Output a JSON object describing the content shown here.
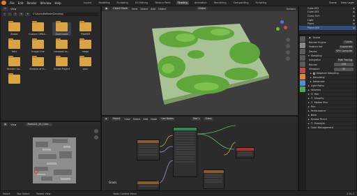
{
  "menubar": {
    "items": [
      "File",
      "Edit",
      "Render",
      "Window",
      "Help"
    ],
    "workspaces": [
      "Layout",
      "Modeling",
      "Sculpting",
      "UV Editing",
      "Texture Paint",
      "Shading",
      "Animation",
      "Rendering",
      "Compositing",
      "Scripting"
    ],
    "active_workspace": "Shading",
    "scene": "Scene",
    "view_layer": "View Layer"
  },
  "filebrowser": {
    "header": [
      "View"
    ],
    "path": "C:\\Users\\Raffaele\\Desktop\\",
    "folders": [
      "Adobe",
      "Custom Office...",
      "Downloads",
      "FRAMER",
      "Hdrs",
      "Image-Line",
      "Lossepel Le...",
      "mega",
      "Reclaim Ga...",
      "Shadow of th...",
      "Unreal Project",
      "vpsn",
      ""
    ]
  },
  "viewport": {
    "menu": [
      "Object Mode",
      "View",
      "Select",
      "Add",
      "Object"
    ],
    "global": "Global",
    "options": "Options"
  },
  "outliner": {
    "items": [
      "Cube.003",
      "Cube.003",
      "Grass Turf",
      "Light",
      "Plane",
      "Plane.000"
    ]
  },
  "properties": {
    "scene": "Scene",
    "render_engine": {
      "label": "Render Engine",
      "value": "Cycles"
    },
    "feature_set": {
      "label": "Feature Set",
      "value": "Supported"
    },
    "device": {
      "label": "Device",
      "value": "GPU Compute"
    },
    "sampling": "Sampling",
    "integrator": "Integrator",
    "integrator_value": "Path Tracing",
    "render_label": "Render",
    "render_value": "128",
    "viewport_label": "Viewport",
    "viewport_value": "32",
    "subsections": [
      "Adaptive Sampling",
      "Denoising",
      "Advanced"
    ],
    "panels": [
      "Light Paths",
      "Volumes",
      "Hair",
      "Simplify",
      "Motion Blur",
      "Film",
      "Performance",
      "Bake",
      "Grease Pencil",
      "Freestyle",
      "Color Management"
    ]
  },
  "image_editor": {
    "view": "View",
    "image_name": "Rock022_2K_Color..."
  },
  "node_editor": {
    "menu": [
      "Object",
      "View",
      "Select",
      "Add",
      "Node"
    ],
    "use_nodes": "Use Nodes",
    "slot": "Slot 1",
    "material": "Grass",
    "label": "Grass"
  },
  "statusbar": {
    "left": [
      "Select",
      "Box Select",
      "Rotate View"
    ],
    "center": "Node Context Menu",
    "right": "2.91.2"
  }
}
